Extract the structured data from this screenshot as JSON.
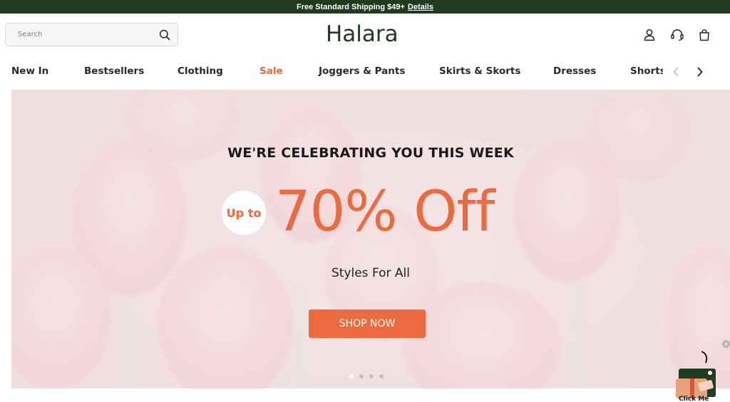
{
  "announcement": {
    "text": "Free Standard Shipping $49+",
    "link": "Details"
  },
  "header": {
    "search_placeholder": "Search",
    "logo": "Halara",
    "icons": [
      "search-icon",
      "account-icon",
      "support-headset-icon",
      "shopping-bag-icon"
    ]
  },
  "nav": {
    "items": [
      {
        "label": "New In"
      },
      {
        "label": "Bestsellers"
      },
      {
        "label": "Clothing"
      },
      {
        "label": "Sale"
      },
      {
        "label": "Joggers & Pants"
      },
      {
        "label": "Skirts & Skorts"
      },
      {
        "label": "Dresses"
      },
      {
        "label": "Shorts"
      }
    ],
    "arrows": [
      "chevron-left-icon",
      "chevron-right-icon"
    ]
  },
  "hero": {
    "title": "WE'RE CELEBRATING YOU THIS WEEK",
    "upto": "Up to",
    "offer": "70% Off",
    "subtitle": "Styles For All",
    "cta": "SHOP NOW",
    "slides": 4,
    "active_slide": 1
  },
  "promo": {
    "label": "Click Me",
    "close": "×"
  },
  "colors": {
    "brand_green": "#203a1f",
    "accent_orange": "#ec6a3f",
    "hero_pink": "#f0dde0"
  }
}
